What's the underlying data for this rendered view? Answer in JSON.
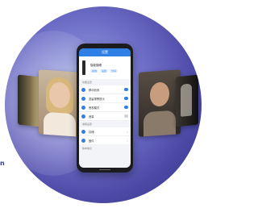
{
  "stray_text": "n",
  "phone": {
    "appbar_title": "设置",
    "device": {
      "name": "智能猫眼",
      "pills": [
        "在线",
        "设置",
        "分享"
      ]
    },
    "sections": [
      {
        "title": "功能设置",
        "rows": [
          {
            "label": "移动侦测",
            "control": "toggle-on"
          },
          {
            "label": "逗留报警提示",
            "control": "toggle-on"
          },
          {
            "label": "夜视模式",
            "control": "toggle-on"
          },
          {
            "label": "音量",
            "control": "toggle-off"
          }
        ]
      },
      {
        "title": "通用设置",
        "rows": [
          {
            "label": "存储",
            "control": "chevron"
          },
          {
            "label": "固件",
            "control": "chevron"
          }
        ]
      }
    ],
    "footer": "版本信息"
  }
}
